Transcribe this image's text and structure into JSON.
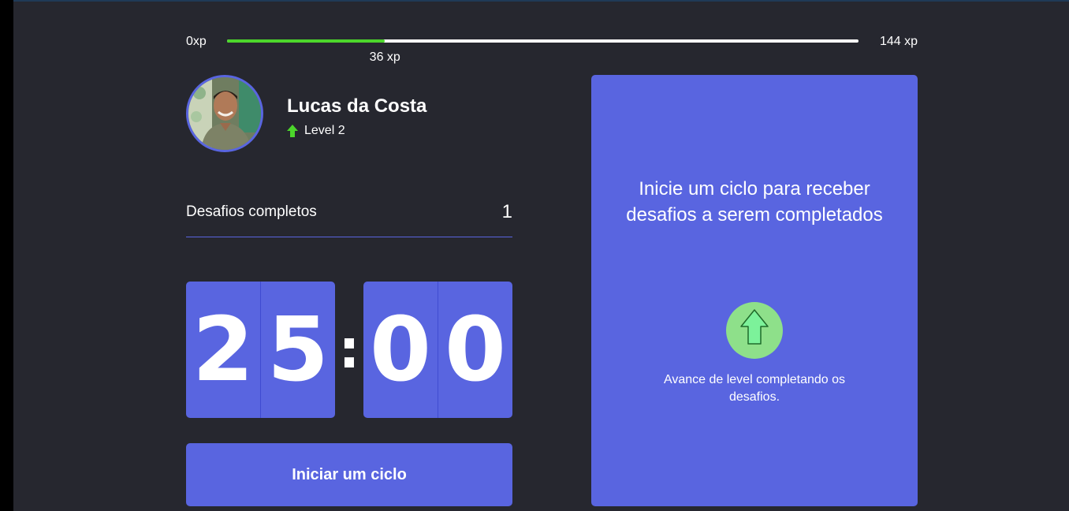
{
  "xp": {
    "min_label": "0xp",
    "max_label": "144 xp",
    "current_label": "36 xp",
    "progress_fraction": 0.25,
    "fill_color": "#4cd62b"
  },
  "profile": {
    "name": "Lucas da Costa",
    "level_label": "Level 2",
    "level_icon": "level-up-arrow-icon",
    "avatar": "user-avatar"
  },
  "challenges": {
    "completed_label": "Desafios completos",
    "completed_count": "1"
  },
  "countdown": {
    "minute_left": "2",
    "minute_right": "5",
    "separator": ":",
    "second_left": "0",
    "second_right": "0"
  },
  "actions": {
    "start_cycle_label": "Iniciar um ciclo"
  },
  "challenge_box": {
    "title": "Inicie um ciclo para receber desafios a serem completados",
    "icon": "level-up-icon",
    "hint": "Avance de level completando os desafios."
  },
  "colors": {
    "background": "#26272f",
    "accent": "#5965e0",
    "success": "#4cd62b",
    "text": "#ffffff"
  }
}
